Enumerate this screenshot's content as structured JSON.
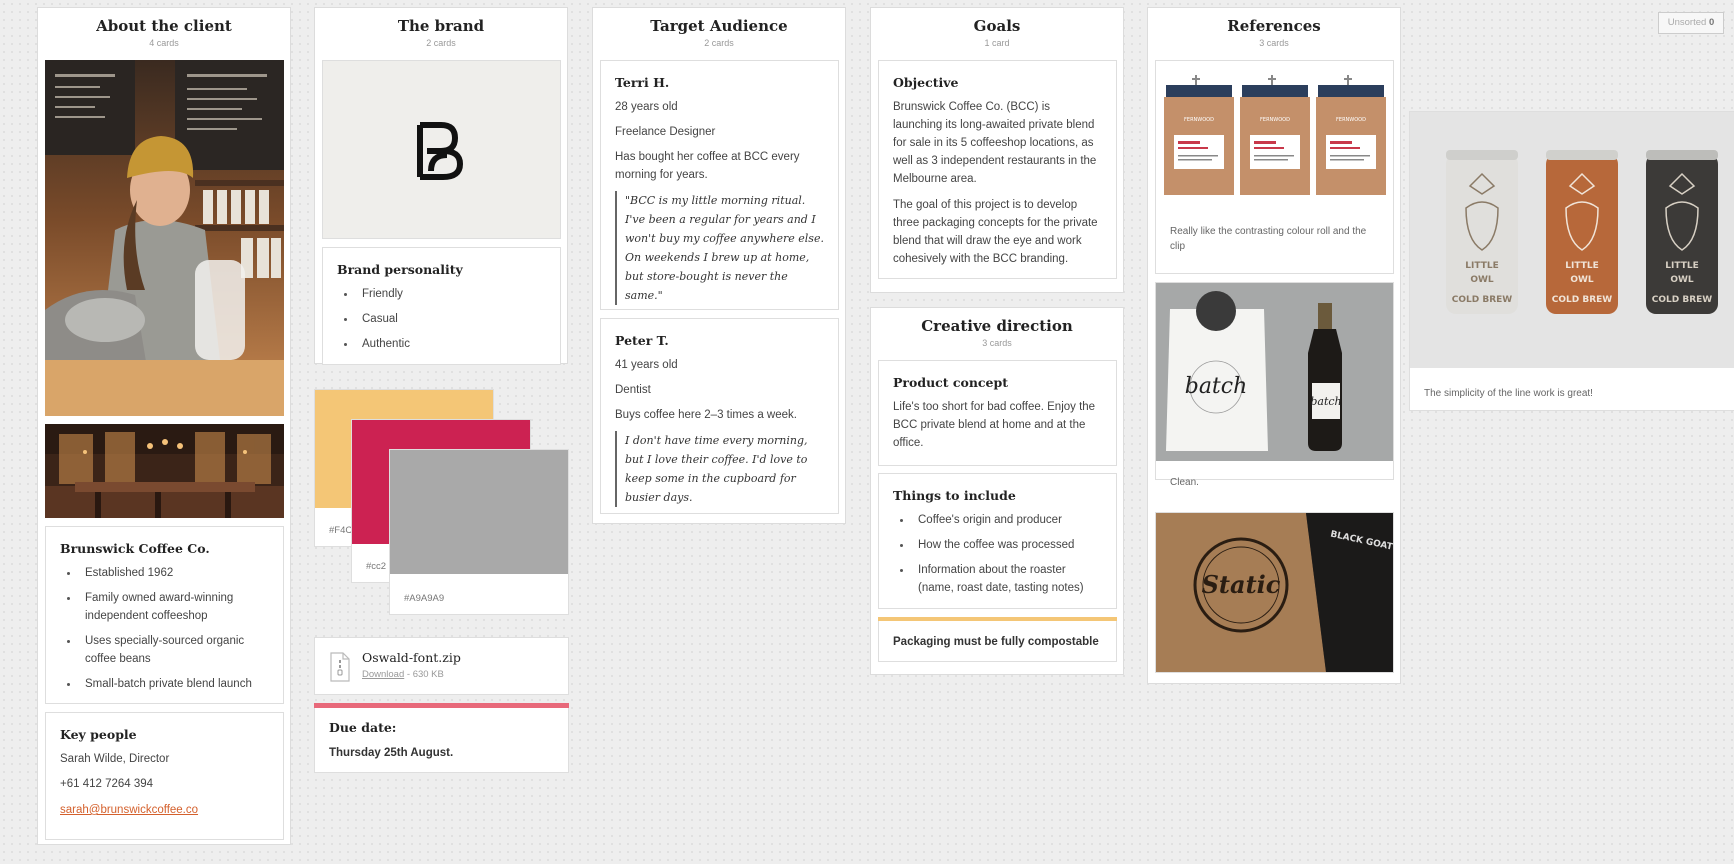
{
  "unsorted": {
    "label": "Unsorted",
    "count": "0"
  },
  "columns": {
    "client": {
      "title": "About the client",
      "count": "4 cards"
    },
    "brand": {
      "title": "The brand",
      "count": "2 cards"
    },
    "audience": {
      "title": "Target Audience",
      "count": "2 cards"
    },
    "goals": {
      "title": "Goals",
      "count": "1 card"
    },
    "creative": {
      "title": "Creative direction",
      "count": "3 cards"
    },
    "references": {
      "title": "References",
      "count": "3 cards"
    }
  },
  "client": {
    "company": {
      "title": "Brunswick Coffee Co.",
      "items": [
        "Established 1962",
        "Family owned award-winning independent coffeeshop",
        "Uses specially-sourced organic coffee beans",
        "Small-batch private blend launch"
      ]
    },
    "people": {
      "title": "Key people",
      "name": "Sarah Wilde, Director",
      "phone": "+61 412 7264 394",
      "email": "sarah@brunswickcoffee.co"
    }
  },
  "brand": {
    "personality": {
      "title": "Brand personality",
      "items": [
        "Friendly",
        "Casual",
        "Authentic"
      ]
    },
    "swatches": [
      {
        "label": "#F4C",
        "color": "#F4C676"
      },
      {
        "label": "#cc2",
        "color": "#CC2252"
      },
      {
        "label": "#A9A9A9",
        "color": "#A9A9A9"
      }
    ],
    "file": {
      "name": "Oswald-font.zip",
      "download": "Download",
      "size": "- 630 KB"
    },
    "due": {
      "title": "Due date:",
      "value": "Thursday 25th August.",
      "accent": "#E8697A"
    }
  },
  "audience": {
    "persona1": {
      "name": "Terri H.",
      "age": "28 years old",
      "job": "Freelance Designer",
      "habit": "Has bought her coffee at BCC every morning for years.",
      "quote": "\"BCC is my little morning ritual. I've been a regular for years and I won't buy my coffee anywhere else. On weekends I brew up at home, but store-bought is never the same.\""
    },
    "persona2": {
      "name": "Peter T.",
      "age": "41 years old",
      "job": "Dentist",
      "habit": "Buys coffee here 2–3 times a week.",
      "quote": "I don't have time every morning, but I love their coffee. I'd love to keep some in the cupboard for busier days."
    }
  },
  "goals": {
    "objective": {
      "title": "Objective",
      "p1": "Brunswick Coffee Co. (BCC) is launching its long-awaited private blend for sale in its 5 coffeeshop locations, as well as 3 independent restaurants in the Melbourne area.",
      "p2": "The goal of this project is to develop three packaging concepts for the private blend that will draw the eye and work cohesively with the BCC branding."
    }
  },
  "creative": {
    "concept": {
      "title": "Product concept",
      "text": "Life's too short for bad coffee. Enjoy the BCC private blend at home and at the office."
    },
    "include": {
      "title": "Things to include",
      "items": [
        "Coffee's origin and producer",
        "How the coffee was processed",
        "Information about the roaster (name, roast date, tasting notes)"
      ]
    },
    "note": {
      "text": "Packaging must be fully compostable",
      "accent": "#F4C676"
    }
  },
  "references": {
    "bags_caption": "Really like the contrasting colour roll and the clip",
    "batch_caption": "Clean.",
    "cans_caption": "The simplicity of the line work is great!",
    "bag_brand": "FERNWOOD",
    "batch_word": "batch",
    "static_word": "Static",
    "goat_word": "BLACK GOAT",
    "can_words": [
      "LITTLE",
      "OWL",
      "COLD BREW"
    ]
  }
}
